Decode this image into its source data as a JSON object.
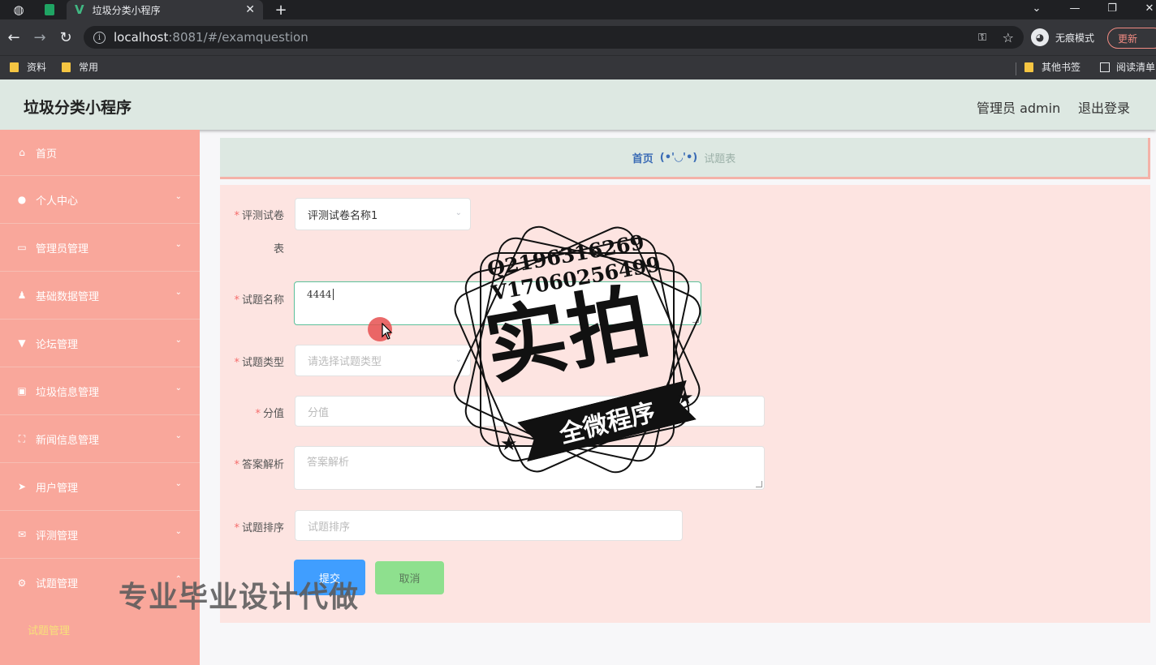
{
  "browser": {
    "tab_title": "垃圾分类小程序",
    "url_host": "localhost",
    "url_rest": ":8081/#/examquestion",
    "incognito_label": "无痕模式",
    "update_label": "更新",
    "bookmarks": [
      "资料",
      "常用"
    ],
    "other_bookmarks": "其他书签",
    "reading_list": "阅读清单"
  },
  "header": {
    "app_title": "垃圾分类小程序",
    "admin_label": "管理员 admin",
    "logout": "退出登录"
  },
  "sidebar": {
    "items": [
      {
        "label": "首页",
        "icon": "home-icon"
      },
      {
        "label": "个人中心",
        "icon": "user-icon"
      },
      {
        "label": "管理员管理",
        "icon": "id-card-icon"
      },
      {
        "label": "基础数据管理",
        "icon": "person-icon"
      },
      {
        "label": "论坛管理",
        "icon": "pin-icon"
      },
      {
        "label": "垃圾信息管理",
        "icon": "trash-icon"
      },
      {
        "label": "新闻信息管理",
        "icon": "scan-icon"
      },
      {
        "label": "用户管理",
        "icon": "send-icon"
      },
      {
        "label": "评测管理",
        "icon": "mail-icon"
      },
      {
        "label": "试题管理",
        "icon": "gear-icon"
      }
    ],
    "sub_item": "试题管理"
  },
  "breadcrumb": {
    "home": "首页",
    "separator": "(•'◡'•)",
    "current": "试题表"
  },
  "form": {
    "paper_label_line1": "评测试卷",
    "paper_label_line2": "表",
    "paper_value": "评测试卷名称1",
    "name_label": "试题名称",
    "name_value": "4444",
    "type_label": "试题类型",
    "type_placeholder": "请选择试题类型",
    "score_label": "分值",
    "score_placeholder": "分值",
    "analysis_label": "答案解析",
    "analysis_placeholder": "答案解析",
    "order_label": "试题排序",
    "order_placeholder": "试题排序",
    "submit": "提交",
    "cancel": "取消"
  },
  "watermark": {
    "qq": "Q2196316269",
    "vx": "V17060256499",
    "main": "实拍",
    "banner": "全微程序",
    "bottom": "专业毕业设计代做"
  }
}
